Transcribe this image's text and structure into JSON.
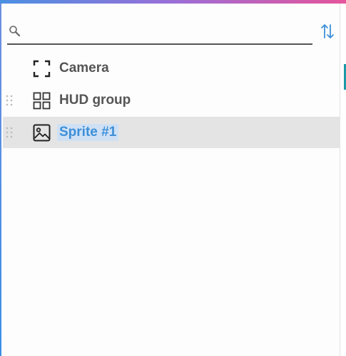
{
  "search": {
    "placeholder": "",
    "value": ""
  },
  "items": [
    {
      "label": "Camera",
      "icon": "camera-frame-icon",
      "draggable": false,
      "selected": false
    },
    {
      "label": "HUD group",
      "icon": "grid-group-icon",
      "draggable": true,
      "selected": false
    },
    {
      "label": "Sprite #1",
      "icon": "image-icon",
      "draggable": true,
      "selected": true
    }
  ],
  "colors": {
    "accent": "#3d8fd8",
    "selected_row": "#e4e4e4",
    "selected_label_bg": "#cfe0f4",
    "text": "#555555"
  }
}
